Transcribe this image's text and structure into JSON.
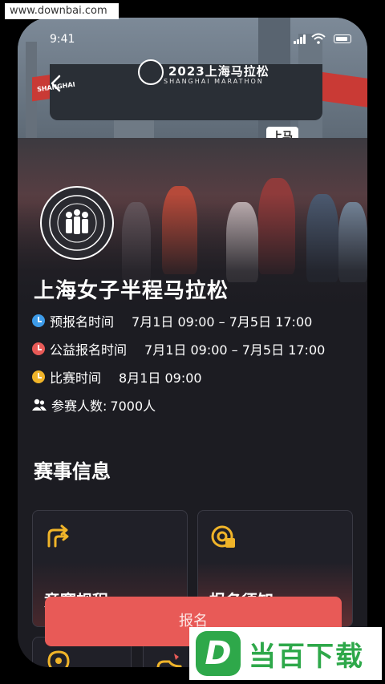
{
  "watermark_top": "www.downbai.com",
  "status_bar": {
    "time": "9:41"
  },
  "hero": {
    "arch_title": "2023上海马拉松",
    "arch_subtitle": "SHANGHAI MARATHON",
    "sign_left": "SHANGHAI",
    "sign_right": "上马"
  },
  "event": {
    "title": "上海女子半程马拉松",
    "pre_registration": {
      "label": "预报名时间",
      "value": "7月1日 09:00 – 7月5日 17:00",
      "color": "#3d9be9"
    },
    "charity_registration": {
      "label": "公益报名时间",
      "value": "7月1日 09:00 – 7月5日 17:00",
      "color": "#e85a57"
    },
    "race_time": {
      "label": "比赛时间",
      "value": "8月1日 09:00",
      "color": "#f0b429"
    },
    "participants": {
      "label": "参赛人数:",
      "value": "7000人"
    }
  },
  "section_title": "赛事信息",
  "cards": [
    {
      "label": "竞赛规程",
      "icon": "route-arrows-icon"
    },
    {
      "label": "报名须知",
      "icon": "target-badge-icon"
    },
    {
      "label": "",
      "icon": "location-pin-icon"
    },
    {
      "label": "",
      "icon": "shoe-icon"
    }
  ],
  "signup_button": "报名",
  "brand_watermark": {
    "letter": "D",
    "text": "当百下载"
  },
  "colors": {
    "accent": "#e85a57",
    "icon_yellow": "#f0b429",
    "background": "#1c1c22"
  }
}
